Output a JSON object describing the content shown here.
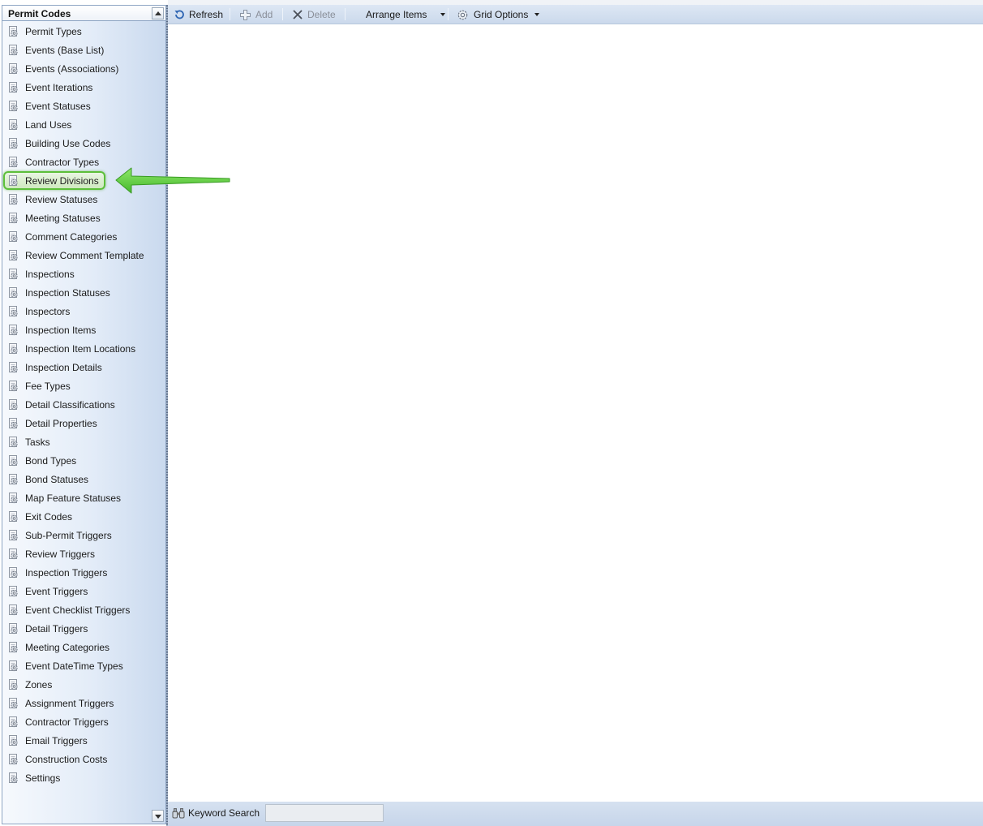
{
  "sidebar": {
    "title": "Permit Codes",
    "items": [
      {
        "label": "Permit Types"
      },
      {
        "label": "Events (Base List)"
      },
      {
        "label": "Events (Associations)"
      },
      {
        "label": "Event Iterations"
      },
      {
        "label": "Event Statuses"
      },
      {
        "label": "Land Uses"
      },
      {
        "label": "Building Use Codes"
      },
      {
        "label": "Contractor Types"
      },
      {
        "label": "Review Divisions",
        "selected": true
      },
      {
        "label": "Review Statuses"
      },
      {
        "label": "Meeting Statuses"
      },
      {
        "label": "Comment Categories"
      },
      {
        "label": "Review Comment Template"
      },
      {
        "label": "Inspections"
      },
      {
        "label": "Inspection Statuses"
      },
      {
        "label": "Inspectors"
      },
      {
        "label": "Inspection Items"
      },
      {
        "label": "Inspection Item Locations"
      },
      {
        "label": "Inspection Details"
      },
      {
        "label": "Fee Types"
      },
      {
        "label": "Detail Classifications"
      },
      {
        "label": "Detail Properties"
      },
      {
        "label": "Tasks"
      },
      {
        "label": "Bond Types"
      },
      {
        "label": "Bond Statuses"
      },
      {
        "label": "Map Feature Statuses"
      },
      {
        "label": "Exit Codes"
      },
      {
        "label": "Sub-Permit Triggers"
      },
      {
        "label": "Review Triggers"
      },
      {
        "label": "Inspection Triggers"
      },
      {
        "label": "Event Triggers"
      },
      {
        "label": "Event Checklist Triggers"
      },
      {
        "label": "Detail Triggers"
      },
      {
        "label": "Meeting Categories"
      },
      {
        "label": "Event DateTime Types"
      },
      {
        "label": "Zones"
      },
      {
        "label": "Assignment Triggers"
      },
      {
        "label": "Contractor Triggers"
      },
      {
        "label": "Email Triggers"
      },
      {
        "label": "Construction Costs"
      },
      {
        "label": "Settings"
      }
    ]
  },
  "toolbar": {
    "refresh_label": "Refresh",
    "add_label": "Add",
    "delete_label": "Delete",
    "arrange_label": "Arrange Items",
    "grid_options_label": "Grid Options"
  },
  "bottombar": {
    "keyword_search_label": "Keyword Search",
    "keyword_search_value": ""
  },
  "icons": {
    "list_item": "gear-document-icon",
    "refresh": "refresh-icon",
    "add": "plus-icon",
    "delete": "x-icon",
    "grid_options": "gear-icon",
    "keyword_search": "binoculars-icon",
    "annotation": "green-arrow-icon"
  },
  "colors": {
    "highlight_border": "#5cbf3a",
    "annotation_arrow": "#5fcf3c",
    "toolbar_bg": "#cbd9ec"
  }
}
